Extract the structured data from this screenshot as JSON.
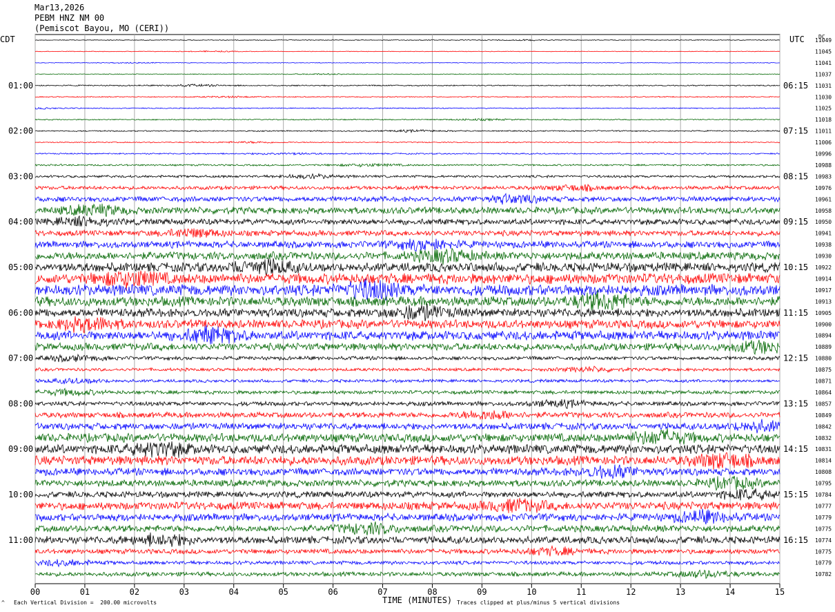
{
  "header": {
    "date": "Mar13,2026",
    "station": "PEBM HNZ NM 00",
    "location": "(Pemiscot Bayou, MO (CERI))"
  },
  "left_label": "CDT",
  "right_label": "UTC",
  "dc_label": "DC",
  "footer": {
    "scale_note": "Each Vertical Division =  200.00 microvolts",
    "xlabel": "TIME (MINUTES)",
    "clip_note": "Traces clipped at plus/minus 5 vertical divisions"
  },
  "colors": {
    "trace_cycle": [
      "#000000",
      "#ff0000",
      "#0000ff",
      "#006600"
    ],
    "grid": "#aaaaaa"
  },
  "chart_data": {
    "type": "line",
    "title": "PEBM HNZ NM 00",
    "xlabel": "TIME (MINUTES)",
    "xlim": [
      0,
      15
    ],
    "x_ticks": [
      "00",
      "01",
      "02",
      "03",
      "04",
      "05",
      "06",
      "07",
      "08",
      "09",
      "10",
      "11",
      "12",
      "13",
      "14",
      "15"
    ],
    "trace_interval_minutes": 15,
    "left_hour_labels": [
      "01:00",
      "02:00",
      "03:00",
      "04:00",
      "05:00",
      "06:00",
      "07:00",
      "08:00",
      "09:00",
      "10:00",
      "11:00"
    ],
    "right_hour_labels": [
      "06:15",
      "07:15",
      "08:15",
      "09:15",
      "10:15",
      "11:15",
      "12:15",
      "13:15",
      "14:15",
      "15:15",
      "16:15"
    ],
    "dc_offsets": [
      11049,
      11045,
      11041,
      11037,
      11031,
      11030,
      11025,
      11018,
      11011,
      11006,
      10996,
      10988,
      10983,
      10976,
      10961,
      10958,
      10950,
      10941,
      10938,
      10930,
      10922,
      10914,
      10917,
      10913,
      10905,
      10900,
      10894,
      10889,
      10880,
      10875,
      10871,
      10864,
      10857,
      10849,
      10842,
      10832,
      10831,
      10814,
      10808,
      10795,
      10784,
      10777,
      10779,
      10775,
      10774,
      10775,
      10779,
      10782
    ],
    "trace_activity": [
      0.6,
      0.5,
      0.5,
      0.6,
      1.0,
      0.8,
      0.8,
      0.9,
      1.0,
      0.9,
      1.1,
      1.4,
      2.0,
      3.0,
      4.2,
      5.5,
      4.8,
      4.5,
      5.5,
      6.5,
      7.5,
      8.5,
      9.0,
      8.0,
      7.0,
      7.0,
      7.5,
      6.0,
      3.0,
      2.5,
      2.5,
      3.0,
      3.5,
      4.5,
      5.5,
      7.0,
      7.5,
      7.5,
      6.0,
      5.5,
      5.0,
      6.5,
      6.0,
      5.5,
      6.0,
      4.0,
      3.0,
      3.5
    ]
  }
}
